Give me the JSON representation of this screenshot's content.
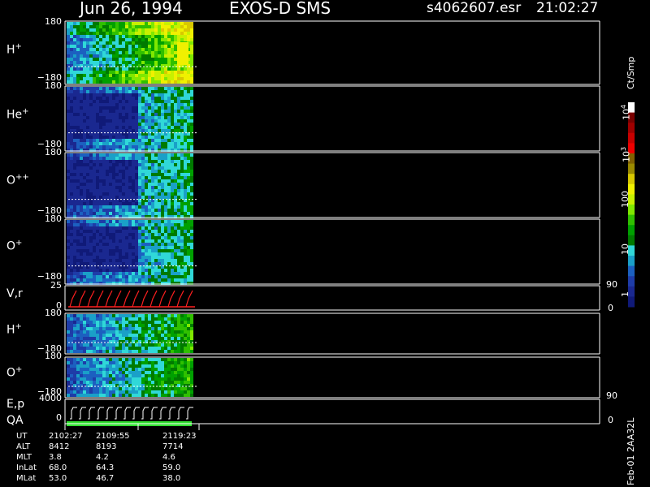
{
  "header": {
    "date": "Jun 26, 1994",
    "instrument": "EXOS-D SMS",
    "file": "s4062607.esr",
    "time": "21:02:27"
  },
  "panels": [
    {
      "id": "h-plus",
      "label": "H",
      "sup": "+",
      "top_tick": "180",
      "bottom_tick": "−180"
    },
    {
      "id": "he-plus",
      "label": "He",
      "sup": "+",
      "top_tick": "180",
      "bottom_tick": "−180"
    },
    {
      "id": "o-plusplus",
      "label": "O",
      "sup": "++",
      "top_tick": "180",
      "bottom_tick": "−180"
    },
    {
      "id": "o-plus",
      "label": "O",
      "sup": "+",
      "top_tick": "180",
      "bottom_tick": "−180"
    },
    {
      "id": "vr",
      "label": "V,r",
      "sup": "",
      "top_tick": "25",
      "bottom_tick": "0",
      "right_top_tick": "90",
      "right_bottom_tick": "0"
    },
    {
      "id": "h-plus-2",
      "label": "H",
      "sup": "+",
      "top_tick": "180",
      "bottom_tick": "−180"
    },
    {
      "id": "o-plus-2",
      "label": "O",
      "sup": "+",
      "top_tick": "180",
      "bottom_tick": "−180"
    },
    {
      "id": "ep-qa",
      "label": "E,p",
      "sub_label": "QA",
      "sup": "",
      "top_tick": "4000",
      "bottom_tick": "0",
      "right_top_tick": "90",
      "right_bottom_tick": "0"
    }
  ],
  "colorbar": {
    "unit": "Ct/Smp",
    "labels": [
      {
        "base": "10",
        "exp": "4"
      },
      {
        "base": "10",
        "exp": "3"
      },
      {
        "base": "100",
        "exp": ""
      },
      {
        "base": "10",
        "exp": ""
      },
      {
        "base": "1",
        "exp": ""
      }
    ],
    "colors": [
      "#ffffff",
      "#7a0000",
      "#a00000",
      "#c80000",
      "#ee0000",
      "#806000",
      "#9a8a00",
      "#d8c800",
      "#f0f000",
      "#c8f000",
      "#80e800",
      "#30c000",
      "#00a000",
      "#007a00",
      "#30d8d8",
      "#1aa0c8",
      "#1c60c0",
      "#1e3ca8",
      "#1a2890",
      "#101a78"
    ],
    "scale": "log",
    "range": [
      1,
      10000
    ]
  },
  "footer_right": "Feb-01 2AA32L",
  "info_table": {
    "rows": [
      {
        "label": "UT",
        "values": [
          "2102:27",
          "2109:55",
          "2119:23"
        ]
      },
      {
        "label": "ALT",
        "values": [
          "8412",
          "8193",
          "7714"
        ]
      },
      {
        "label": "MLT",
        "values": [
          "3.8",
          "4.2",
          "4.6"
        ]
      },
      {
        "label": "InLat",
        "values": [
          "68.0",
          "64.3",
          "59.0"
        ]
      },
      {
        "label": "MLat",
        "values": [
          "53.0",
          "46.7",
          "38.0"
        ]
      }
    ]
  },
  "chart_data": {
    "type": "heatmap",
    "title": "Jun 26, 1994   EXOS-D SMS",
    "time_ticks": [
      "2102:27",
      "2109:55",
      "2119:23"
    ],
    "data_time_range": [
      "2102:27",
      "2119:23"
    ],
    "colorbar_unit": "Ct/Smp",
    "colorbar_range": [
      1,
      10000
    ],
    "series": [
      {
        "name": "H+",
        "ylim": [
          -180,
          180
        ]
      },
      {
        "name": "He+",
        "ylim": [
          -180,
          180
        ]
      },
      {
        "name": "O++",
        "ylim": [
          -180,
          180
        ]
      },
      {
        "name": "O+",
        "ylim": [
          -180,
          180
        ]
      },
      {
        "name": "V,r",
        "ylim": [
          0,
          25
        ],
        "right_ylim": [
          0,
          90
        ]
      },
      {
        "name": "H+",
        "ylim": [
          -180,
          180
        ]
      },
      {
        "name": "O+",
        "ylim": [
          -180,
          180
        ]
      },
      {
        "name": "E,p",
        "ylim": [
          0,
          4000
        ],
        "right_ylim": [
          0,
          90
        ]
      }
    ]
  }
}
